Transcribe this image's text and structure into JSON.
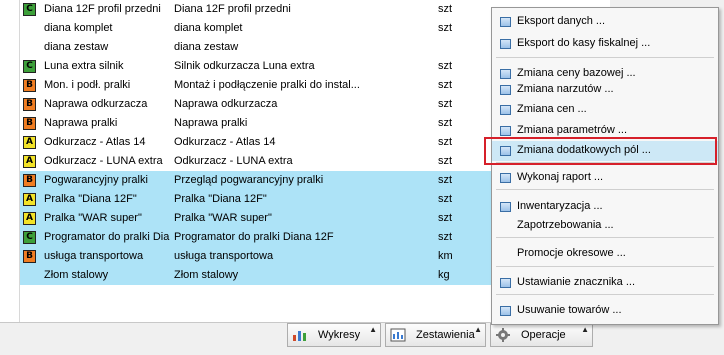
{
  "rows": [
    {
      "badge": "C",
      "badge_color": "#3da03a",
      "name": "Diana 12F profil przedni",
      "desc": "Diana 12F profil przedni",
      "unit": "szt",
      "selected": false
    },
    {
      "badge": "",
      "badge_color": "",
      "name": "diana komplet",
      "desc": "diana komplet",
      "unit": "szt",
      "selected": false
    },
    {
      "badge": "",
      "badge_color": "",
      "name": "diana zestaw",
      "desc": "diana zestaw",
      "unit": "",
      "selected": false
    },
    {
      "badge": "C",
      "badge_color": "#3da03a",
      "name": "Luna extra silnik",
      "desc": "Silnik odkurzacza Luna extra",
      "unit": "szt",
      "selected": false
    },
    {
      "badge": "B",
      "badge_color": "#f07d22",
      "name": "Mon. i podł. pralki",
      "desc": "Montaż i podłączenie pralki do instal...",
      "unit": "szt",
      "selected": false
    },
    {
      "badge": "B",
      "badge_color": "#f07d22",
      "name": "Naprawa odkurzacza",
      "desc": "Naprawa odkurzacza",
      "unit": "szt",
      "selected": false
    },
    {
      "badge": "B",
      "badge_color": "#f07d22",
      "name": "Naprawa pralki",
      "desc": "Naprawa pralki",
      "unit": "szt",
      "selected": false
    },
    {
      "badge": "A",
      "badge_color": "#f2e227",
      "name": "Odkurzacz - Atlas 14",
      "desc": "Odkurzacz - Atlas 14",
      "unit": "szt",
      "selected": false
    },
    {
      "badge": "A",
      "badge_color": "#f2e227",
      "name": "Odkurzacz - LUNA extra",
      "desc": "Odkurzacz - LUNA extra",
      "unit": "szt",
      "selected": false
    },
    {
      "badge": "B",
      "badge_color": "#f07d22",
      "name": "Pogwarancyjny pralki",
      "desc": "Przegląd pogwarancyjny pralki",
      "unit": "szt",
      "selected": true
    },
    {
      "badge": "A",
      "badge_color": "#f2e227",
      "name": "Pralka \"Diana 12F\"",
      "desc": "Pralka \"Diana 12F\"",
      "unit": "szt",
      "selected": true
    },
    {
      "badge": "A",
      "badge_color": "#f2e227",
      "name": "Pralka \"WAR super\"",
      "desc": "Pralka \"WAR super\"",
      "unit": "szt",
      "selected": true
    },
    {
      "badge": "C",
      "badge_color": "#3da03a",
      "name": "Programator do pralki Dia",
      "desc": "Programator do pralki Diana 12F",
      "unit": "szt",
      "selected": true
    },
    {
      "badge": "B",
      "badge_color": "#f07d22",
      "name": "usługa transportowa",
      "desc": "usługa transportowa",
      "unit": "km",
      "selected": true
    },
    {
      "badge": "",
      "badge_color": "",
      "name": "Złom stalowy",
      "desc": "Złom stalowy",
      "unit": "kg",
      "selected": true
    }
  ],
  "toolbar": {
    "wykresy": "Wykresy",
    "zestawienia": "Zestawienia",
    "operacje": "Operacje"
  },
  "menu": {
    "items": [
      {
        "label": "Eksport danych ...",
        "icon": true
      },
      {
        "label": "Eksport do kasy fiskalnej ...",
        "icon": true
      },
      {
        "label": "Zmiana ceny bazowej ...",
        "icon": true
      },
      {
        "label": "Zmiana narzutów ...",
        "icon": true
      },
      {
        "label": "Zmiana cen ...",
        "icon": true
      },
      {
        "label": "Zmiana parametrów ...",
        "icon": true
      },
      {
        "label": "Zmiana dodatkowych pól ...",
        "icon": true,
        "highlighted": true
      },
      {
        "label": "Wykonaj raport ...",
        "icon": true
      },
      {
        "label": "Inwentaryzacja ...",
        "icon": true
      },
      {
        "label": "Zapotrzebowania ...",
        "icon": false
      },
      {
        "label": "Promocje okresowe ...",
        "icon": false
      },
      {
        "label": "Ustawianie znacznika ...",
        "icon": true
      },
      {
        "label": "Usuwanie towarów ...",
        "icon": true
      }
    ]
  },
  "colors": {
    "selection": "#ade3f7",
    "highlight_frame": "#d6202a"
  }
}
